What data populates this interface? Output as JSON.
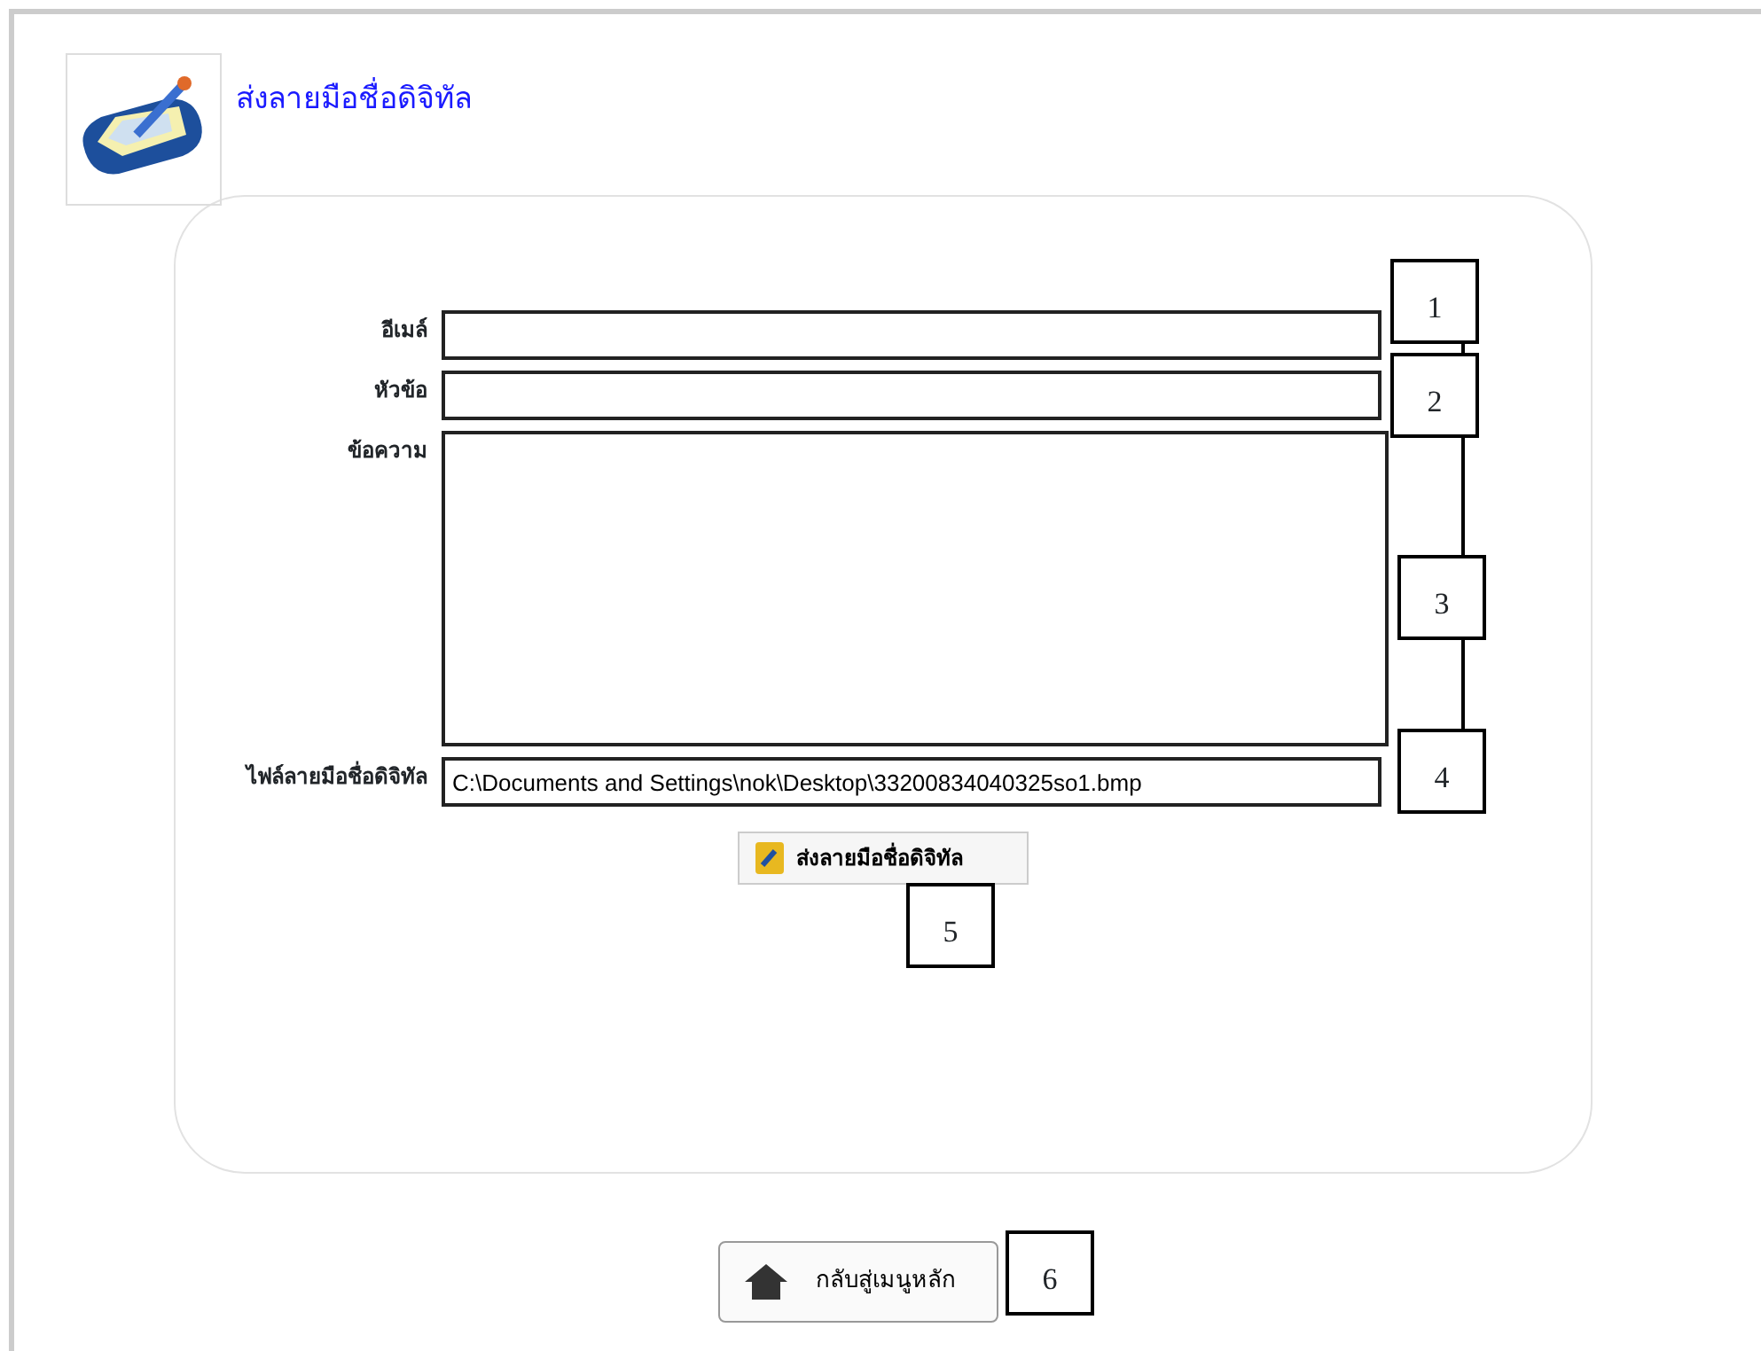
{
  "header": {
    "title": "ส่งลายมือชื่อดิจิทัล"
  },
  "form": {
    "fields": [
      {
        "label": "อีเมล์",
        "kind": "text"
      },
      {
        "label": "หัวข้อ",
        "kind": "text"
      },
      {
        "label": "ข้อความ",
        "kind": "textarea"
      },
      {
        "label": "ไฟล์ลายมือชื่อดิจิทัล",
        "kind": "text",
        "value": "C:\\Documents and Settings\\nok\\Desktop\\33200834040325so1.bmp"
      }
    ],
    "submit_button": {
      "label": "ส่งลายมือชื่อดิจิทัล"
    }
  },
  "back_button": {
    "label": "กลับสู่เมนูหลัก"
  },
  "callouts": [
    "1",
    "2",
    "3",
    "4",
    "5",
    "6"
  ]
}
